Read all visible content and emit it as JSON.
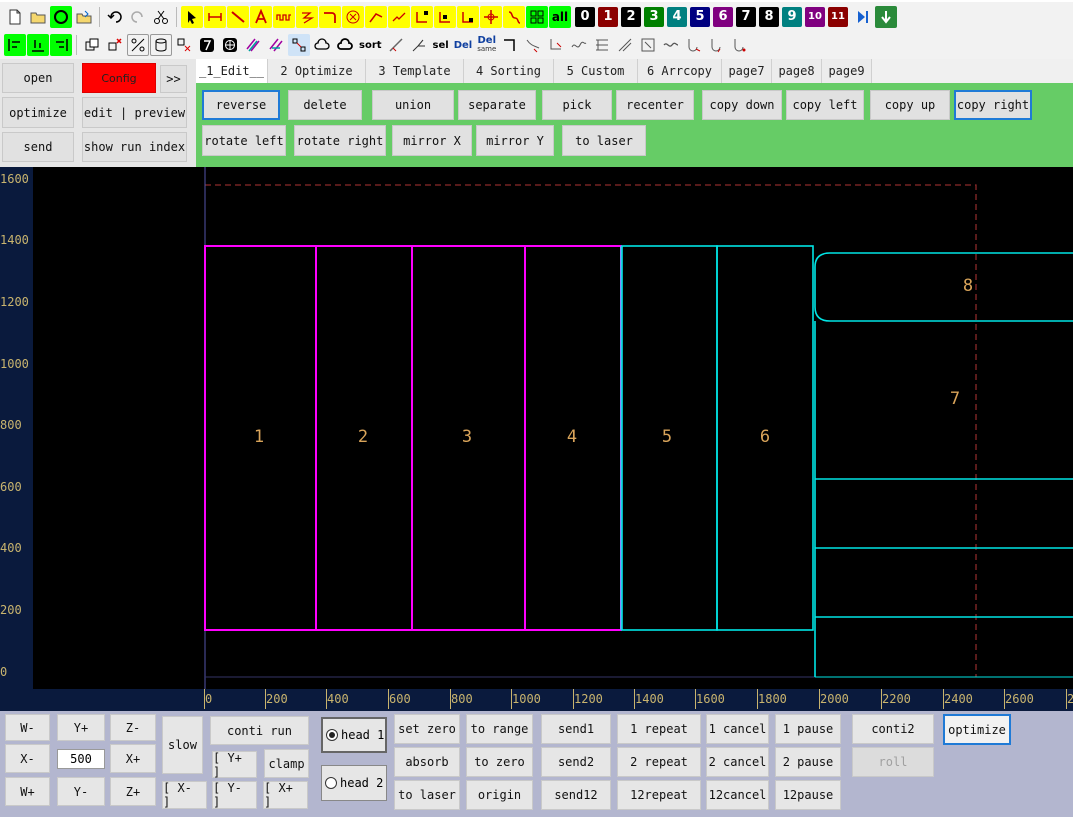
{
  "toolbar1": {
    "icons": [
      "new-file-icon",
      "open-folder-icon",
      "circle-icon",
      "folder-save-icon",
      "undo-icon",
      "redo-icon",
      "cut-icon",
      "select-arrow-icon",
      "dimension-icon",
      "line-icon",
      "text-icon",
      "wave-icon",
      "lightning-icon",
      "arc-icon",
      "target-icon",
      "polyline-icon",
      "zigzag-icon",
      "node-edit-icon",
      "node-add-icon",
      "node-delete-icon",
      "move-icon",
      "node-break-icon",
      "array-icon"
    ],
    "all_label": "all",
    "numbers": [
      {
        "label": "0",
        "color": "#000000"
      },
      {
        "label": "1",
        "color": "#8b0000"
      },
      {
        "label": "2",
        "color": "#000000"
      },
      {
        "label": "3",
        "color": "#008000"
      },
      {
        "label": "4",
        "color": "#008080"
      },
      {
        "label": "5",
        "color": "#000080"
      },
      {
        "label": "6",
        "color": "#800080"
      },
      {
        "label": "7",
        "color": "#000000"
      },
      {
        "label": "8",
        "color": "#000000"
      },
      {
        "label": "9",
        "color": "#008080"
      },
      {
        "label": "10",
        "color": "#800080"
      },
      {
        "label": "11",
        "color": "#8b0000"
      }
    ]
  },
  "toolbar2": {
    "sort_label": "sort",
    "sel_label": "sel",
    "del_label": "Del",
    "del_same_label": "Del",
    "del_same_sub": "same"
  },
  "left_panel": {
    "open": "open",
    "config": "Config",
    "more": ">>",
    "optimize": "optimize",
    "edit_preview": "edit | preview",
    "send": "send",
    "show_run_index": "show run index"
  },
  "tabs": [
    "_1_Edit__",
    "2 Optimize",
    "3 Template",
    "4 Sorting",
    "5 Custom",
    "6 Arrcopy",
    "page7",
    "page8",
    "page9"
  ],
  "edit_buttons_row1": [
    "reverse",
    "delete",
    "union",
    "separate",
    "pick",
    "recenter",
    "copy down",
    "copy left",
    "copy up",
    "copy right"
  ],
  "edit_buttons_row2": [
    "rotate left",
    "rotate right",
    "mirror X",
    "mirror Y",
    "to laser"
  ],
  "canvas": {
    "y_ticks": [
      "1600",
      "1400",
      "1200",
      "1000",
      "800",
      "600",
      "400",
      "200",
      "0"
    ],
    "x_ticks": [
      "0",
      "200",
      "400",
      "600",
      "800",
      "1000",
      "1200",
      "1400",
      "1600",
      "1800",
      "2000",
      "2200",
      "2400",
      "2600",
      "2"
    ],
    "part_labels": [
      "1",
      "2",
      "3",
      "4",
      "5",
      "6",
      "7",
      "8"
    ],
    "colors": {
      "magenta": "#ff00ff",
      "cyan": "#00e5e5",
      "violet": "#8888ff",
      "dash": "#8b2a2a",
      "label": "#d9a45a"
    }
  },
  "bottom": {
    "w_minus": "W-",
    "y_plus": "Y+",
    "z_minus": "Z-",
    "x_minus": "X-",
    "step_value": "500",
    "x_plus": "X+",
    "w_plus": "W+",
    "y_minus": "Y-",
    "z_plus": "Z+",
    "slow": "slow",
    "conti_run": "conti run",
    "bracket_y_plus": "[ Y+ ]",
    "clamp": "clamp",
    "bracket_x_minus": "[ X- ]",
    "bracket_y_minus": "[ Y- ]",
    "bracket_x_plus": "[ X+ ]",
    "head1": "head 1",
    "head2": "head 2",
    "set_zero": "set zero",
    "to_range": "to range",
    "send1": "send1",
    "repeat1": "1 repeat",
    "cancel1": "1 cancel",
    "pause1": "1 pause",
    "conti2": "conti2",
    "optimize": "optimize",
    "absorb": "absorb",
    "to_zero": "to zero",
    "send2": "send2",
    "repeat2": "2 repeat",
    "cancel2": "2 cancel",
    "pause2": "2 pause",
    "roll": "roll",
    "to_laser": "to laser",
    "origin": "origin",
    "send12": "send12",
    "repeat12": "12repeat",
    "cancel12": "12cancel",
    "pause12": "12pause"
  }
}
